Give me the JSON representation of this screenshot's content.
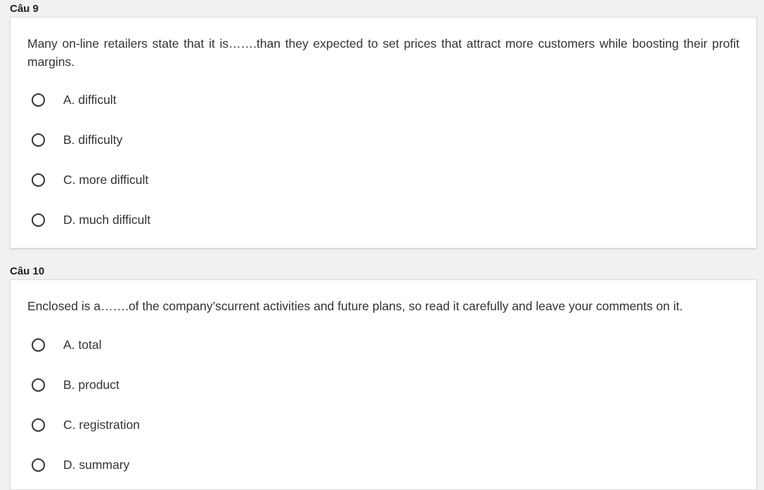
{
  "questions": [
    {
      "label": "Câu 9",
      "text": "Many on-line retailers state that it is…….than they expected to set prices that attract more customers while boosting their profit margins.",
      "options": [
        "A. difficult",
        "B. difficulty",
        "C. more difficult",
        "D. much difficult"
      ]
    },
    {
      "label": "Câu 10",
      "text": "Enclosed is a…….of the company’scurrent activities and future plans, so read it carefully and leave your comments on it.",
      "options": [
        "A. total",
        "B. product",
        "C. registration",
        "D. summary"
      ]
    }
  ]
}
